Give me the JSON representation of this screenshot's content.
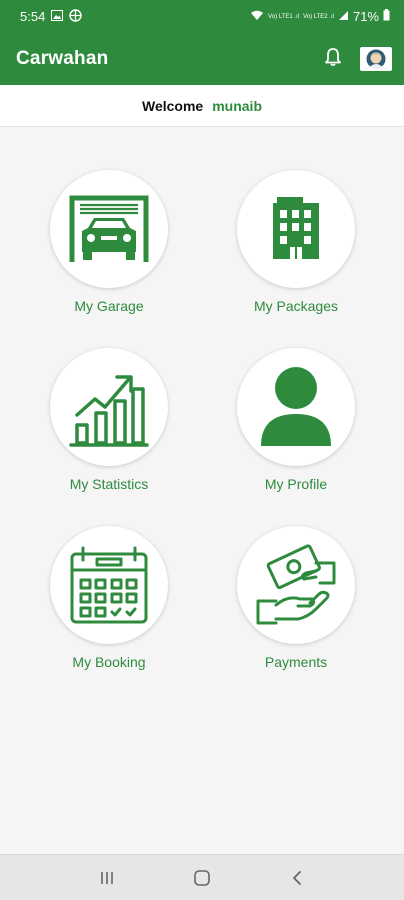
{
  "status_bar": {
    "time": "5:54",
    "network_label": "Vo) LTE1 .ıl",
    "network_label2": "Vo) LTE2 .ıl",
    "battery": "71%",
    "icons": [
      "image-icon",
      "vpn-globe-icon",
      "wifi-icon",
      "signal-icon",
      "battery-icon"
    ]
  },
  "app_bar": {
    "title": "Carwahan",
    "icons": [
      "bell-icon",
      "avatar-icon"
    ]
  },
  "welcome": {
    "label": "Welcome",
    "username": "munaib"
  },
  "menu": {
    "items": [
      {
        "label": "My Garage",
        "icon": "garage-car-icon"
      },
      {
        "label": "My Packages",
        "icon": "building-icon"
      },
      {
        "label": "My Statistics",
        "icon": "bar-chart-trend-icon"
      },
      {
        "label": "My Profile",
        "icon": "user-silhouette-icon"
      },
      {
        "label": "My Booking",
        "icon": "calendar-icon"
      },
      {
        "label": "Payments",
        "icon": "hands-money-icon"
      }
    ]
  },
  "nav_bar": {
    "icons": [
      "recent-apps-icon",
      "home-icon",
      "back-icon"
    ]
  },
  "colors": {
    "primary": "#2e8b3e",
    "background": "#f5f5f5"
  }
}
